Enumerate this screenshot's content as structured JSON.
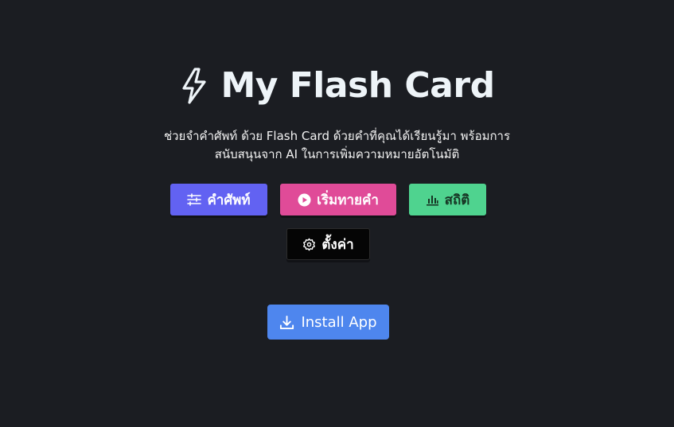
{
  "header": {
    "title": "My Flash Card",
    "icon": "lightning-bolt-icon",
    "subtitle_line1": "ช่วยจำคำศัพท์ ด้วย Flash Card ด้วยคำที่คุณได้เรียนรู้มา พร้อมการ",
    "subtitle_line2": "สนับสนุนจาก AI ในการเพิ่มความหมายอัตโนมัติ"
  },
  "actions": {
    "words_label": "คำศัพท์",
    "words_icon": "sliders-icon",
    "play_label": "เริ่มทายคำ",
    "play_icon": "play-circle-icon",
    "stats_label": "สถิติ",
    "stats_icon": "bar-chart-icon",
    "settings_label": "ตั้งค่า",
    "settings_icon": "gear-icon",
    "install_label": "Install App",
    "install_icon": "download-icon"
  },
  "colors": {
    "background": "#1b1d22",
    "words_button": "#6262f2",
    "play_button": "#e04b98",
    "stats_button": "#4fd38f",
    "settings_button": "#050505",
    "install_button": "#4e86ee"
  }
}
